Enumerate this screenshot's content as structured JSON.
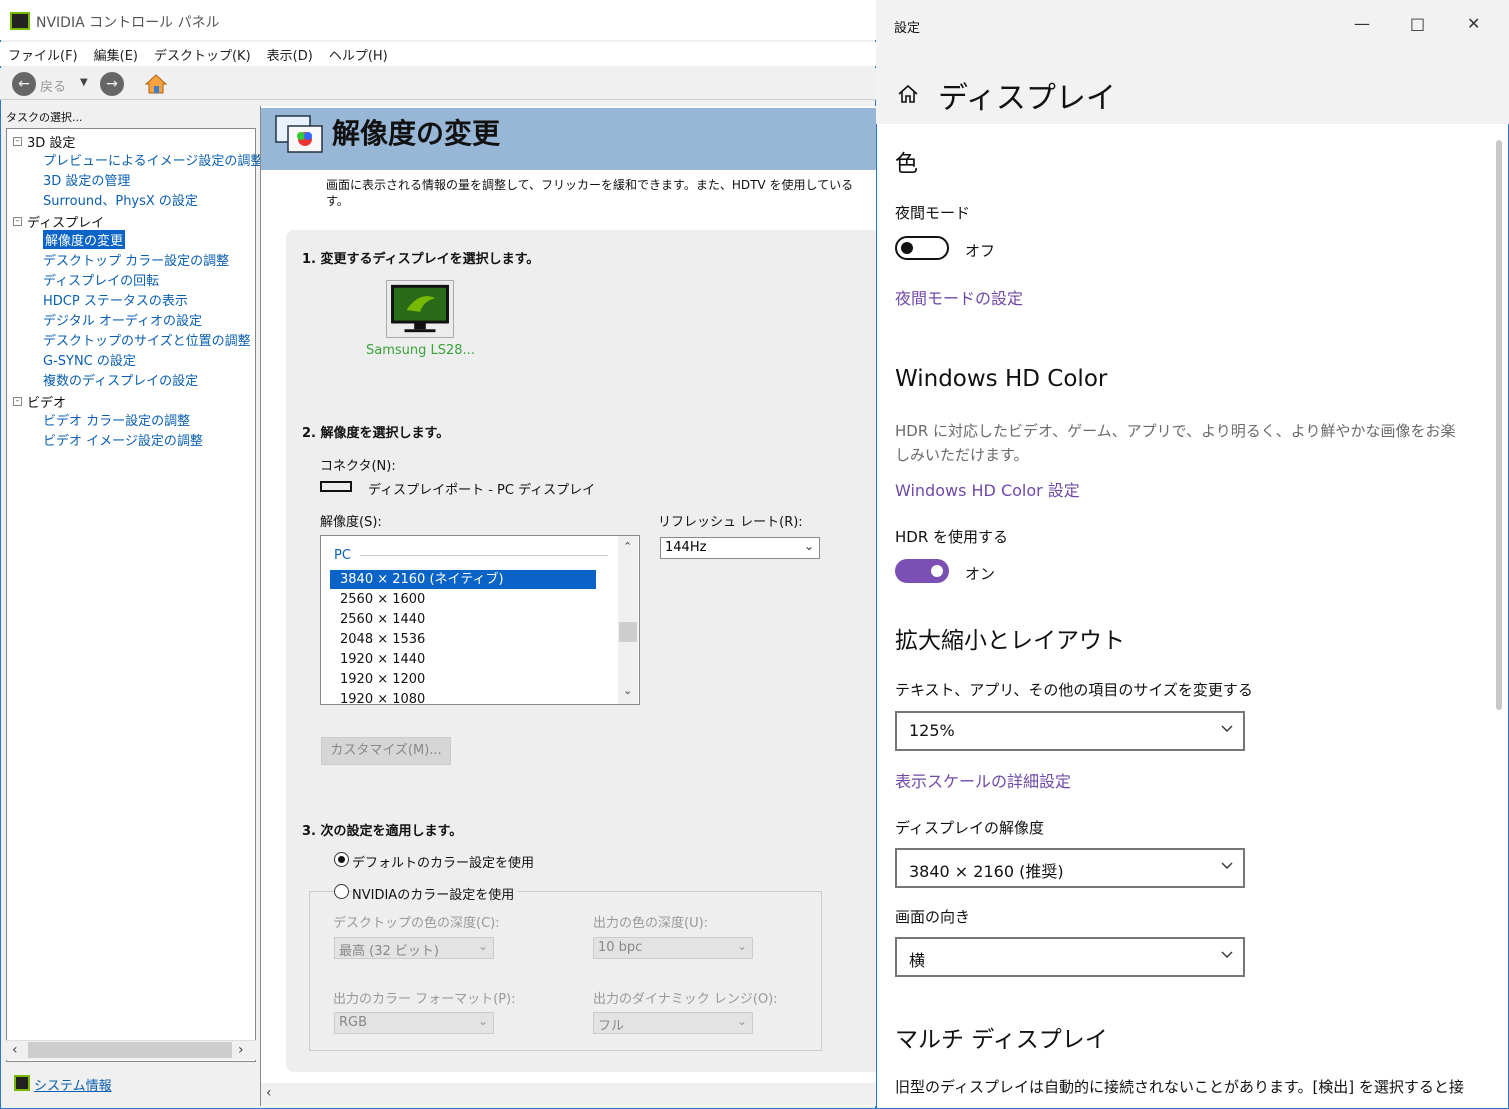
{
  "nvidia": {
    "window_title": "NVIDIA コントロール パネル",
    "menu": [
      "ファイル(F)",
      "編集(E)",
      "デスクトップ(K)",
      "表示(D)",
      "ヘルプ(H)"
    ],
    "toolbar": {
      "back_label": "戻る"
    },
    "task_label": "タスクの選択...",
    "tree": {
      "groups": [
        {
          "label": "3D 設定",
          "items": [
            "プレビューによるイメージ設定の調整",
            "3D 設定の管理",
            "Surround、PhysX の設定"
          ]
        },
        {
          "label": "ディスプレイ",
          "items": [
            "解像度の変更",
            "デスクトップ カラー設定の調整",
            "ディスプレイの回転",
            "HDCP ステータスの表示",
            "デジタル オーディオの設定",
            "デスクトップのサイズと位置の調整",
            "G-SYNC の設定",
            "複数のディスプレイの設定"
          ]
        },
        {
          "label": "ビデオ",
          "items": [
            "ビデオ カラー設定の調整",
            "ビデオ イメージ設定の調整"
          ]
        }
      ],
      "selected": "解像度の変更"
    },
    "system_info": "システム情報",
    "page": {
      "title": "解像度の変更",
      "description": "画面に表示される情報の量を調整して、フリッカーを緩和できます。また、HDTV を使用している",
      "description_cont": "す。",
      "step1": "1. 変更するディスプレイを選択します。",
      "monitor_name": "Samsung LS28...",
      "step2": "2. 解像度を選択します。",
      "connector_label": "コネクタ(N):",
      "connector_value": "ディスプレイポート - PC ディスプレイ",
      "resolution_label": "解像度(S):",
      "refresh_label": "リフレッシュ レート(R):",
      "refresh_value": "144Hz",
      "res_group": "PC",
      "resolutions": [
        "3840 × 2160 (ネイティブ)",
        "2560 × 1600",
        "2560 × 1440",
        "2048 × 1536",
        "1920 × 1440",
        "1920 × 1200",
        "1920 × 1080"
      ],
      "selected_resolution": "3840 × 2160 (ネイティブ)",
      "customize_button": "カスタマイズ(M)...",
      "step3": "3. 次の設定を適用します。",
      "radio_default": "デフォルトのカラー設定を使用",
      "radio_nvidia": "NVIDIAのカラー設定を使用",
      "desktop_depth_label": "デスクトップの色の深度(C):",
      "desktop_depth_value": "最高 (32 ビット)",
      "output_depth_label": "出力の色の深度(U):",
      "output_depth_value": "10 bpc",
      "color_format_label": "出力のカラー フォーマット(P):",
      "color_format_value": "RGB",
      "dynamic_range_label": "出力のダイナミック レンジ(O):",
      "dynamic_range_value": "フル"
    }
  },
  "settings": {
    "window_title": "設定",
    "page_title": "ディスプレイ",
    "color_heading": "色",
    "night_mode_label": "夜間モード",
    "night_mode_state": "オフ",
    "night_mode_link": "夜間モードの設定",
    "hd_color_heading": "Windows HD Color",
    "hd_color_desc": "HDR に対応したビデオ、ゲーム、アプリで、より明るく、より鮮やかな画像をお楽しみいただけます。",
    "hd_color_link": "Windows HD Color 設定",
    "hdr_label": "HDR を使用する",
    "hdr_state": "オン",
    "scale_heading": "拡大縮小とレイアウト",
    "scale_label": "テキスト、アプリ、その他の項目のサイズを変更する",
    "scale_value": "125%",
    "scale_link": "表示スケールの詳細設定",
    "resolution_label": "ディスプレイの解像度",
    "resolution_value": "3840 × 2160 (推奨)",
    "orientation_label": "画面の向き",
    "orientation_value": "横",
    "multi_heading": "マルチ ディスプレイ",
    "multi_desc": "旧型のディスプレイは自動的に接続されないことがあります。[検出] を選択すると接"
  }
}
